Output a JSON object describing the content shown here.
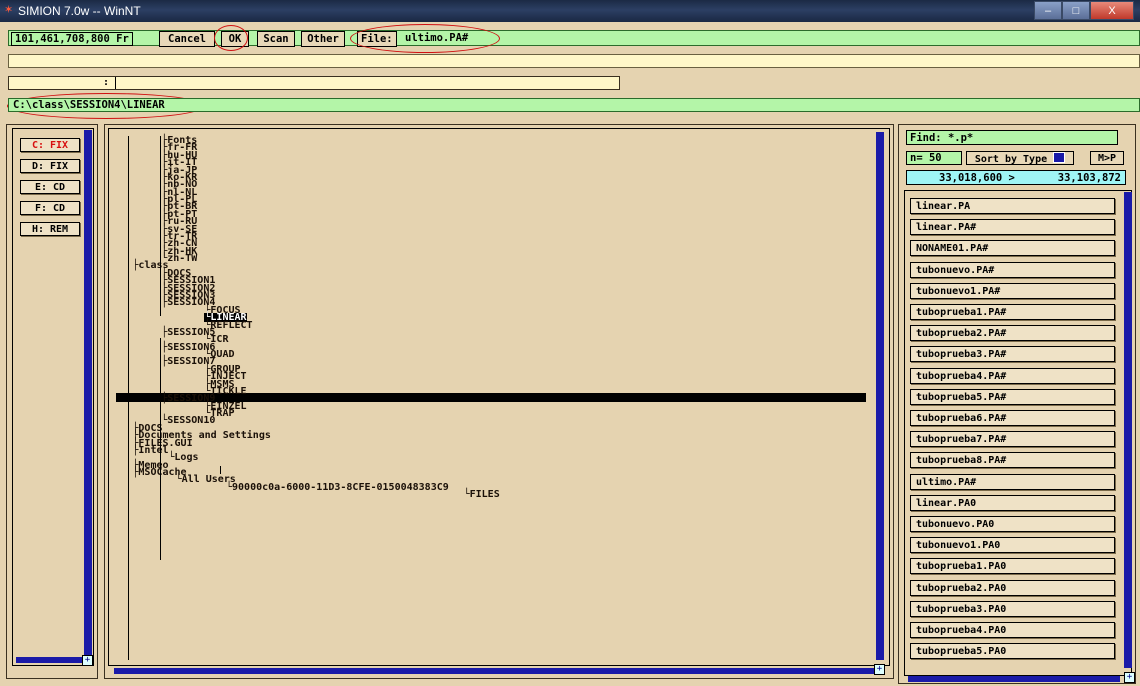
{
  "window": {
    "title": "SIMION 7.0w -- WinNT",
    "min_label": "–",
    "max_label": "□",
    "close_label": "X"
  },
  "toolbar": {
    "free_bytes": "101,461,708,800 Fr",
    "cancel_label": "Cancel",
    "ok_label": "OK",
    "scan_label": "Scan",
    "other_label": "Other",
    "file_label": "File:",
    "file_value": "ultimo.PA#"
  },
  "input_row": {
    "separator": ":"
  },
  "path": "C:\\class\\SESSION4\\LINEAR",
  "drives": [
    {
      "label": "C: FIX"
    },
    {
      "label": "D: FIX"
    },
    {
      "label": "E:  CD"
    },
    {
      "label": "F:  CD"
    },
    {
      "label": "H: REM"
    }
  ],
  "tree": [
    "Fonts",
    "fr-FR",
    "hu-HU",
    "it-IT",
    "ja-JP",
    "ko-KR",
    "nb-NO",
    "nl-NL",
    "pl-PL",
    "pt-BR",
    "pt-PT",
    "ru-RU",
    "sv-SE",
    "tr-TR",
    "zh-CN",
    "zh-HK",
    "zh-TW",
    "class",
    "DOCS",
    "SESSION1",
    "SESSION2",
    "SESSION3",
    "SESSION4",
    "FOCUS",
    "LINEAR",
    "REFLECT",
    "SESSION5",
    "ICR",
    "SESSION6",
    "QUAD",
    "SESSION7",
    "GROUP",
    "INJECT",
    "MSMS",
    "TICKLE",
    "SESSION9",
    "EINZEL",
    "TRAP",
    "SESSON10",
    "DOCS",
    "Documents and Settings",
    "FILES.GUI",
    "Intel",
    "Logs",
    "Memeo",
    "MSOCache",
    "All Users",
    "90000c0a-6000-11D3-8CFE-0150048383C9",
    "FILES"
  ],
  "find": {
    "label": "Find:",
    "value": "*.p*"
  },
  "count": {
    "label": "n=",
    "value": "50"
  },
  "sort_label": "Sort by Type",
  "mp_label": "M>P",
  "range": {
    "from": "33,018,600 >",
    "to": "33,103,872"
  },
  "files": [
    "linear.PA",
    "linear.PA#",
    "NONAME01.PA#",
    "tubonuevo.PA#",
    "tubonuevo1.PA#",
    "tuboprueba1.PA#",
    "tuboprueba2.PA#",
    "tuboprueba3.PA#",
    "tuboprueba4.PA#",
    "tuboprueba5.PA#",
    "tuboprueba6.PA#",
    "tuboprueba7.PA#",
    "tuboprueba8.PA#",
    "ultimo.PA#",
    "linear.PA0",
    "tubonuevo.PA0",
    "tubonuevo1.PA0",
    "tuboprueba1.PA0",
    "tuboprueba2.PA0",
    "tuboprueba3.PA0",
    "tuboprueba4.PA0",
    "tuboprueba5.PA0"
  ],
  "scroll_corner": "+",
  "colors": {
    "accent_green": "#b4f5a8",
    "panel": "#e5d3b0",
    "scroll": "#1a1aa8",
    "annotation": "#d01010"
  }
}
